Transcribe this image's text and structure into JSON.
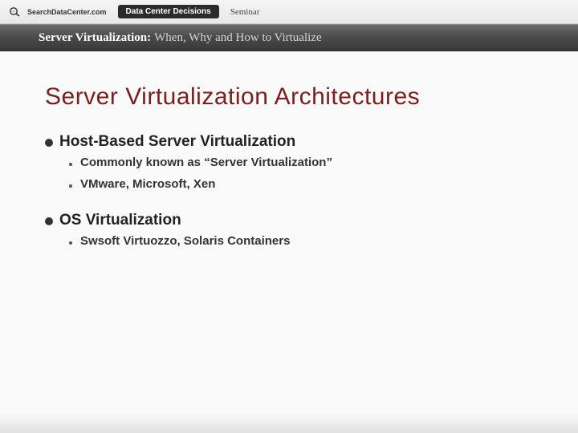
{
  "header": {
    "brand": "SearchDataCenter.com",
    "pill": "Data Center Decisions",
    "seminar": "Seminar"
  },
  "title_band": {
    "strong": "Server Virtualization:",
    "light": "When, Why and How to Virtualize"
  },
  "slide": {
    "title": "Server Virtualization Architectures",
    "sections": [
      {
        "heading": "Host-Based Server Virtualization",
        "items": [
          "Commonly known as “Server Virtualization”",
          "VMware, Microsoft, Xen"
        ]
      },
      {
        "heading": "OS Virtualization",
        "items": [
          "Swsoft Virtuozzo, Solaris Containers"
        ]
      }
    ]
  }
}
